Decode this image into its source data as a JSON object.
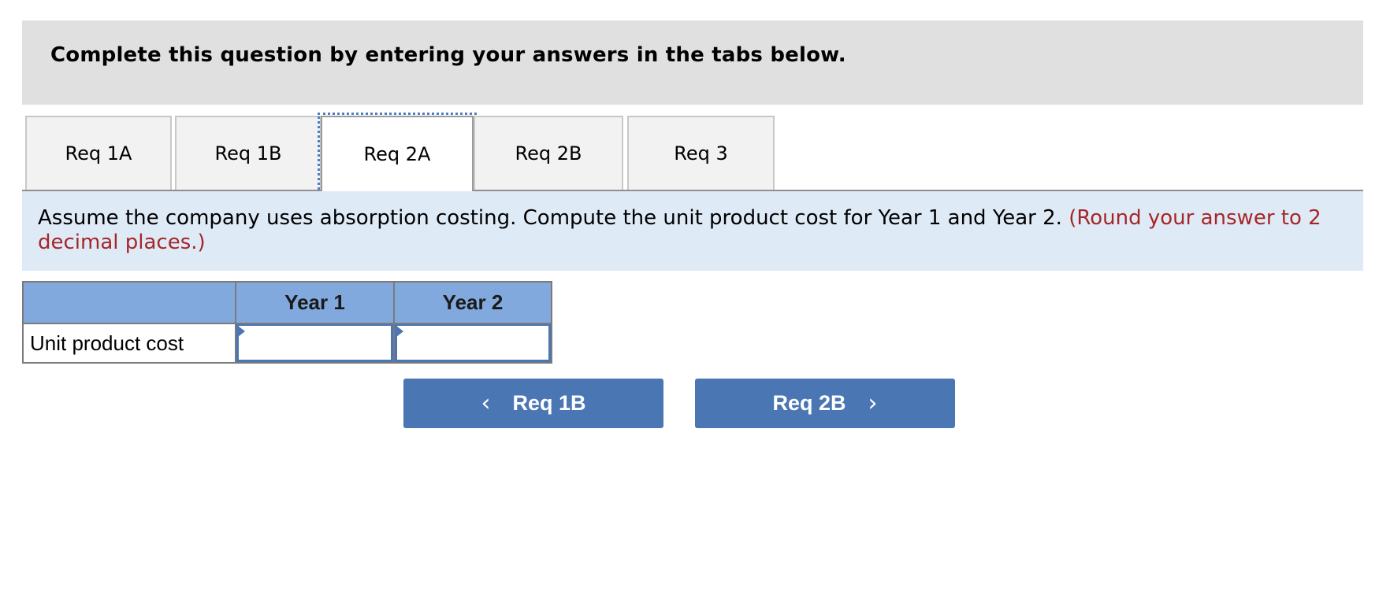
{
  "header": {
    "instruction": "Complete this question by entering your answers in the tabs below."
  },
  "tabs": [
    {
      "label": "Req 1A",
      "active": false
    },
    {
      "label": "Req 1B",
      "active": false
    },
    {
      "label": "Req 2A",
      "active": true
    },
    {
      "label": "Req 2B",
      "active": false
    },
    {
      "label": "Req 3",
      "active": false
    }
  ],
  "question": {
    "text": "Assume the company uses absorption costing. Compute the unit product cost for Year 1 and Year 2.",
    "note": "(Round your answer to 2 decimal places.)"
  },
  "table": {
    "columns": [
      "",
      "Year 1",
      "Year 2"
    ],
    "rows": [
      {
        "label": "Unit product cost",
        "values": [
          "",
          ""
        ]
      }
    ]
  },
  "navigation": {
    "prev_label": "Req 1B",
    "next_label": "Req 2B",
    "prev_icon": "chevron-left-icon",
    "next_icon": "chevron-right-icon"
  },
  "colors": {
    "header_bg": "#e0e0e0",
    "panel_bg": "#dfeaf7",
    "table_header_bg": "#82a9dd",
    "button_bg": "#4a76b4",
    "note_red": "#a52626"
  }
}
